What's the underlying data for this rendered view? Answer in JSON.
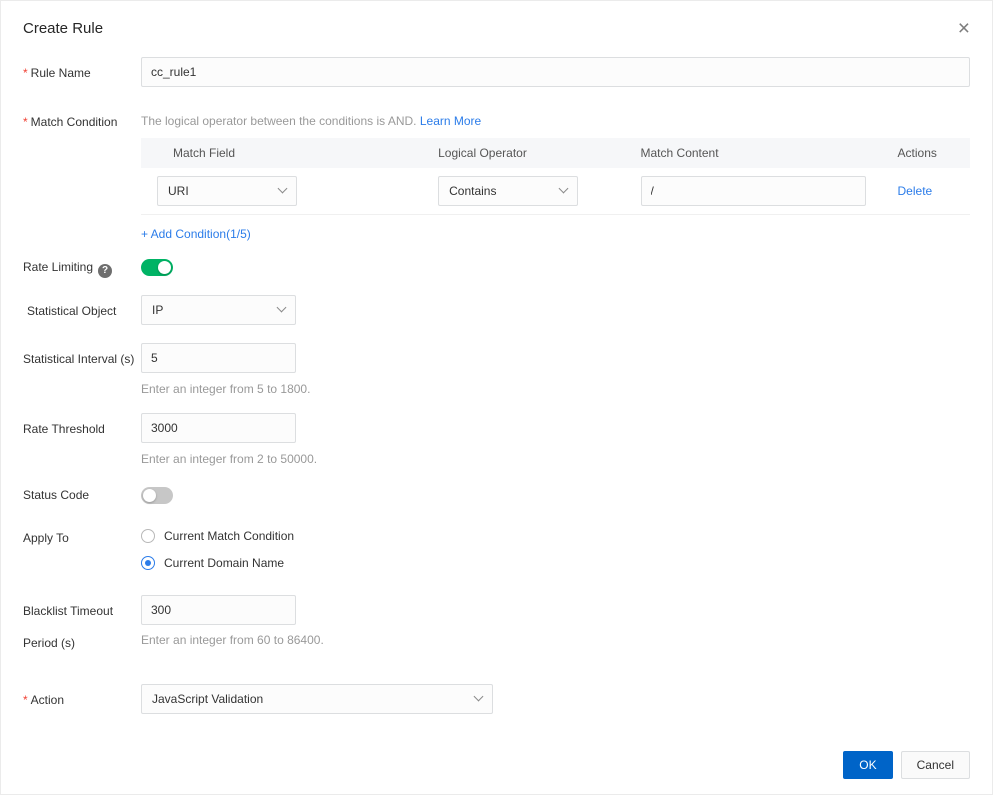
{
  "dialog": {
    "title": "Create Rule"
  },
  "icons": {
    "close": "×",
    "help": "?"
  },
  "required_marker": "*",
  "rule_name": {
    "label": "Rule Name",
    "value": "cc_rule1"
  },
  "match_condition": {
    "label": "Match Condition",
    "description": "The logical operator between the conditions is AND.",
    "learn_more": "Learn More",
    "headers": [
      "Match Field",
      "Logical Operator",
      "Match Content",
      "Actions"
    ],
    "row": {
      "match_field": "URI",
      "logical_operator": "Contains",
      "match_content": "/",
      "delete": "Delete"
    },
    "add_condition": "+ Add Condition(1/5)"
  },
  "rate_limiting": {
    "label": "Rate Limiting",
    "on": true
  },
  "statistical_object": {
    "label": "Statistical Object",
    "value": "IP"
  },
  "statistical_interval": {
    "label": "Statistical Interval (s)",
    "value": "5",
    "hint": "Enter an integer from 5 to 1800."
  },
  "rate_threshold": {
    "label": "Rate Threshold",
    "value": "3000",
    "hint": "Enter an integer from 2 to 50000."
  },
  "status_code": {
    "label": "Status Code",
    "on": false
  },
  "apply_to": {
    "label": "Apply To",
    "options": [
      {
        "label": "Current Match Condition",
        "checked": false
      },
      {
        "label": "Current Domain Name",
        "checked": true
      }
    ]
  },
  "blacklist_timeout": {
    "label": "Blacklist Timeout Period (s)",
    "value": "300",
    "hint": "Enter an integer from 60 to 86400."
  },
  "action": {
    "label": "Action",
    "value": "JavaScript Validation"
  },
  "footer": {
    "ok": "OK",
    "cancel": "Cancel"
  },
  "colors": {
    "link": "#2b7ce9",
    "primary_button": "#0064c8",
    "toggle_on": "#00b365",
    "required": "#f04134"
  }
}
